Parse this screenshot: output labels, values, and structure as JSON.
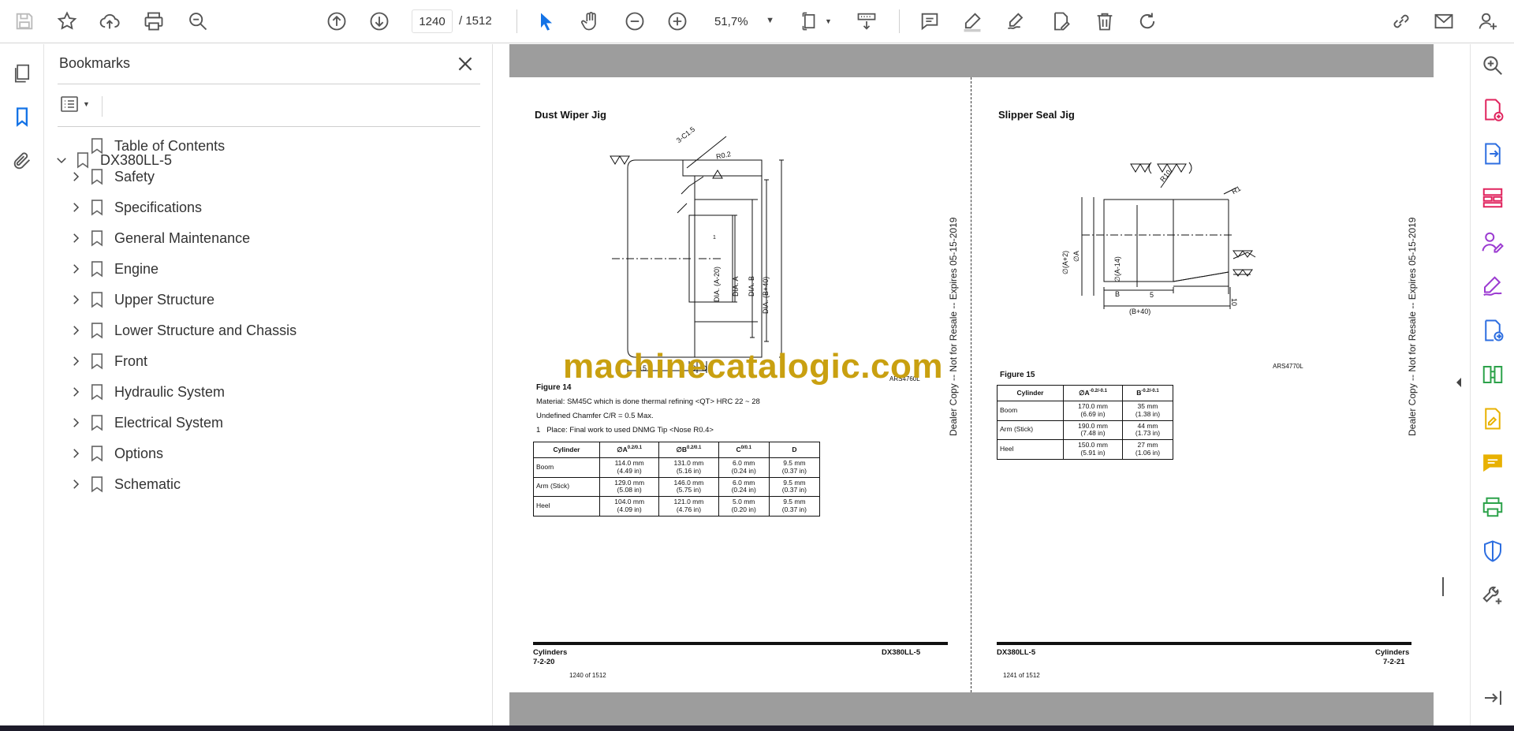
{
  "toolbar": {
    "page_current": "1240",
    "page_total": "/  1512",
    "zoom": "51,7%"
  },
  "bookmarks": {
    "title": "Bookmarks",
    "root": "DX380LL-5",
    "items": [
      {
        "label": "Table of Contents",
        "expandable": false
      },
      {
        "label": "Safety",
        "expandable": true
      },
      {
        "label": "Specifications",
        "expandable": true
      },
      {
        "label": "General Maintenance",
        "expandable": true
      },
      {
        "label": "Engine",
        "expandable": true
      },
      {
        "label": "Upper Structure",
        "expandable": true
      },
      {
        "label": "Lower Structure and Chassis",
        "expandable": true
      },
      {
        "label": "Front",
        "expandable": true
      },
      {
        "label": "Hydraulic System",
        "expandable": true
      },
      {
        "label": "Electrical System",
        "expandable": true
      },
      {
        "label": "Options",
        "expandable": true
      },
      {
        "label": "Schematic",
        "expandable": true
      }
    ]
  },
  "left_page": {
    "heading": "Dust Wiper Jig",
    "drawing_labels": {
      "chamfer": "3-C1.5",
      "radius": "R0.2",
      "dia_a20": "DIA. (A-20)",
      "dia_a": "DIA. A",
      "dia_b": "DIA. B",
      "dia_b40": "DIA. (B+40)",
      "dim_15": "15",
      "dim_c": "C",
      "dim_d": "D",
      "ref": "ARS4760L",
      "callout": "1"
    },
    "figure": "Figure 14",
    "notes": [
      "Material: SM45C which is done thermal refining <QT> HRC 22 ~ 28",
      "Undefined Chamfer C/R = 0.5 Max."
    ],
    "note_numbered": {
      "num": "1",
      "text": "Place: Final work to used DNMG Tip <Nose R0.4>"
    },
    "table": {
      "headers": [
        "Cylinder",
        "∅A",
        "∅B",
        "C",
        "D"
      ],
      "header_tol": [
        "",
        "0.2/0.1",
        "0.2/0.1",
        "0/0.1",
        ""
      ],
      "rows": [
        [
          "Boom",
          "114.0 mm",
          "(4.49 in)",
          "131.0 mm",
          "(5.16 in)",
          "6.0 mm",
          "(0.24 in)",
          "9.5 mm",
          "(0.37 in)"
        ],
        [
          "Arm (Stick)",
          "129.0 mm",
          "(5.08 in)",
          "146.0 mm",
          "(5.75 in)",
          "6.0 mm",
          "(0.24 in)",
          "9.5 mm",
          "(0.37 in)"
        ],
        [
          "Heel",
          "104.0 mm",
          "(4.09 in)",
          "121.0 mm",
          "(4.76 in)",
          "5.0 mm",
          "(0.20 in)",
          "9.5 mm",
          "(0.37 in)"
        ]
      ]
    },
    "side_stamp": "Dealer Copy -- Not for Resale -- Expires 05-15-2019",
    "footer_left_1": "Cylinders",
    "footer_left_2": "7-2-20",
    "footer_right": "DX380LL-5",
    "page_count": "1240 of 1512"
  },
  "right_page": {
    "heading": "Slipper Seal Jig",
    "drawing_labels": {
      "r10": "R10",
      "r1": "R1",
      "dia_a2": "∅(A+2)",
      "dia_a": "∅A",
      "dia_a14": "∅(A-14)",
      "dim_b": "B",
      "dim_b40": "(B+40)",
      "dim_5": "5",
      "dim_10": "10",
      "ref": "ARS4770L"
    },
    "figure": "Figure 15",
    "table": {
      "headers": [
        "Cylinder",
        "∅A",
        "B"
      ],
      "header_tol": [
        "",
        "-0.2/-0.1",
        "-0.2/-0.1"
      ],
      "rows": [
        [
          "Boom",
          "170.0 mm",
          "(6.69 in)",
          "35 mm",
          "(1.38 in)"
        ],
        [
          "Arm (Stick)",
          "190.0 mm",
          "(7.48 in)",
          "44 mm",
          "(1.73 in)"
        ],
        [
          "Heel",
          "150.0 mm",
          "(5.91 in)",
          "27 mm",
          "(1.06 in)"
        ]
      ]
    },
    "side_stamp": "Dealer Copy -- Not for Resale -- Expires 05-15-2019",
    "footer_left": "DX380LL-5",
    "footer_right_1": "Cylinders",
    "footer_right_2": "7-2-21",
    "page_count": "1241 of 1512"
  },
  "overlay_watermark": "machinecatalogic.com",
  "colors": {
    "accent_blue": "#1473e6",
    "watermark_gold": "#c9a010",
    "tool_pink": "#e0245e",
    "tool_blue": "#2d6ee0",
    "tool_purple": "#9b3ad1",
    "tool_yellow": "#e8b100",
    "tool_green": "#2ca24a"
  }
}
